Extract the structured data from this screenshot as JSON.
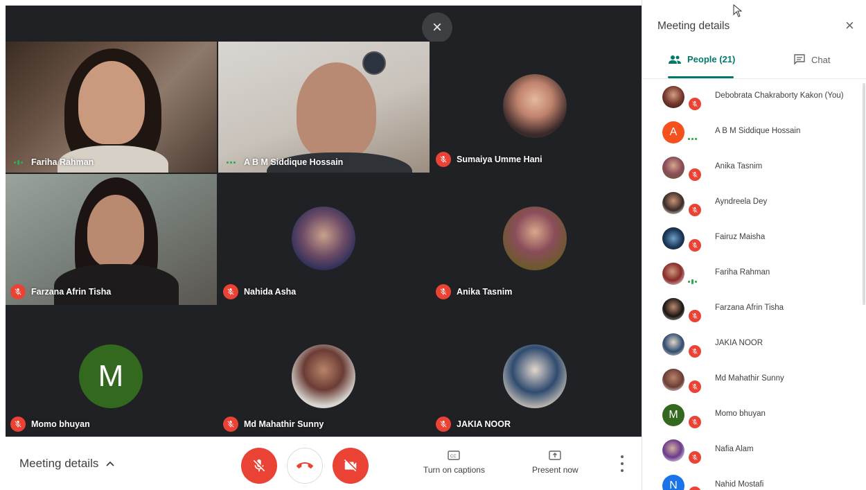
{
  "overlay": {
    "close_glyph": "×"
  },
  "tiles": [
    {
      "name": "Fariha Rahman",
      "status": "speaking"
    },
    {
      "name": "A B M Siddique Hossain",
      "status": "speaking"
    },
    {
      "name": "Sumaiya Umme Hani",
      "status": "muted"
    },
    {
      "name": "Farzana Afrin Tisha",
      "status": "muted"
    },
    {
      "name": "Nahida Asha",
      "status": "muted"
    },
    {
      "name": "Anika Tasnim",
      "status": "muted"
    },
    {
      "name": "Momo bhuyan",
      "status": "muted",
      "avatar_letter": "M"
    },
    {
      "name": "Md Mahathir Sunny",
      "status": "muted"
    },
    {
      "name": "JAKIA NOOR",
      "status": "muted"
    }
  ],
  "bottom_bar": {
    "meeting_details_label": "Meeting details",
    "captions_label": "Turn on captions",
    "present_label": "Present now"
  },
  "panel": {
    "title": "Meeting details",
    "close_glyph": "×",
    "tab_people": "People (21)",
    "tab_chat": "Chat",
    "participants": [
      {
        "name": "Debobrata Chakraborty Kakon (You)",
        "status": "muted"
      },
      {
        "name": "A B M Siddique Hossain",
        "status": "speaking",
        "avatar_letter": "A"
      },
      {
        "name": "Anika Tasnim",
        "status": "muted"
      },
      {
        "name": "Ayndreela Dey",
        "status": "muted"
      },
      {
        "name": "Fairuz Maisha",
        "status": "muted"
      },
      {
        "name": "Fariha Rahman",
        "status": "speaking"
      },
      {
        "name": "Farzana Afrin Tisha",
        "status": "muted"
      },
      {
        "name": "JAKIA NOOR",
        "status": "muted"
      },
      {
        "name": "Md Mahathir Sunny",
        "status": "muted"
      },
      {
        "name": "Momo bhuyan",
        "status": "muted",
        "avatar_letter": "M"
      },
      {
        "name": "Nafia Alam",
        "status": "muted"
      },
      {
        "name": "Nahid Mostafi",
        "status": "muted",
        "avatar_letter": "N"
      }
    ]
  },
  "colors": {
    "accent_teal": "#00796b",
    "danger_red": "#ea4335",
    "speaking_green": "#34a853",
    "stage_dark": "#202124"
  }
}
